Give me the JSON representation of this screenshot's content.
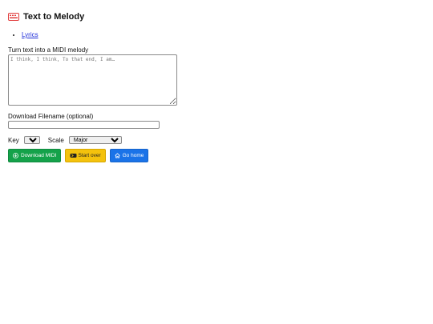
{
  "header": {
    "title": "Text to Melody",
    "icon": "keyboard-icon",
    "icon_color": "#e13b3b"
  },
  "nav": {
    "items": [
      {
        "label": "Lyrics"
      }
    ]
  },
  "form": {
    "prompt_label": "Turn text into a MIDI melody",
    "text_placeholder": "I think, I think, To that end, I am…",
    "filename_label": "Download Filename (optional)",
    "filename_value": "",
    "key_label": "Key",
    "key_value": "C",
    "scale_label": "Scale",
    "scale_value": "Major"
  },
  "actions": {
    "download_label": "Download MIDI",
    "start_over_label": "Start over",
    "home_label": "Go home"
  },
  "colors": {
    "download": "#14a24a",
    "start_over": "#f4c20d",
    "home": "#1a73e8",
    "link": "#1d2bd8"
  }
}
